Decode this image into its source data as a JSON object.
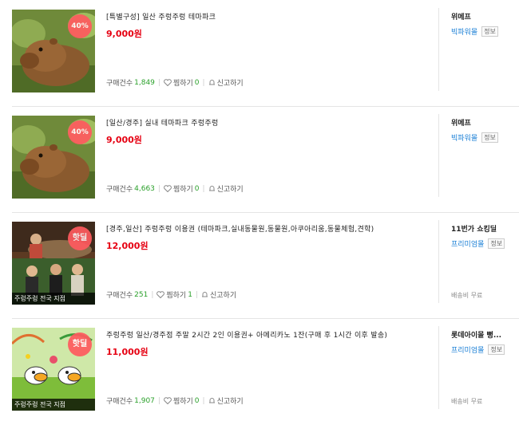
{
  "items": [
    {
      "badge": "40%",
      "caption": "",
      "title": "[특별구성] 일산 주렁주렁 테마파크",
      "price": "9,000원",
      "purchase_label": "구매건수",
      "purchase_count": "1,849",
      "wish_label": "찜하기",
      "wish_count": "0",
      "report_label": "신고하기",
      "seller_name": "위메프",
      "seller_grade": "빅파워몰",
      "info_label": "정보",
      "shipping": ""
    },
    {
      "badge": "40%",
      "caption": "",
      "title": "[일산/경주] 실내 테마파크 주렁주렁",
      "price": "9,000원",
      "purchase_label": "구매건수",
      "purchase_count": "4,663",
      "wish_label": "찜하기",
      "wish_count": "0",
      "report_label": "신고하기",
      "seller_name": "위메프",
      "seller_grade": "빅파워몰",
      "info_label": "정보",
      "shipping": ""
    },
    {
      "badge": "핫딜",
      "caption": "주렁주렁 전국 지점",
      "title": "[경주,일산] 주렁주렁 이용권 (테마파크,실내동물원,동물원,아쿠아리움,동물체험,견학)",
      "price": "12,000원",
      "purchase_label": "구매건수",
      "purchase_count": "251",
      "wish_label": "찜하기",
      "wish_count": "1",
      "report_label": "신고하기",
      "seller_name": "11번가 쇼킹딜",
      "seller_grade": "프리미엄몰",
      "info_label": "정보",
      "shipping": "배송비 무료"
    },
    {
      "badge": "핫딜",
      "caption": "주렁주렁 전국 지점",
      "title": "주렁주렁 일산/경주점 주말 2시간 2인 이용권+ 아메리카노 1잔(구매 후 1시간 이후 발송)",
      "price": "11,000원",
      "purchase_label": "구매건수",
      "purchase_count": "1,907",
      "wish_label": "찜하기",
      "wish_count": "0",
      "report_label": "신고하기",
      "seller_name": "롯데아이몰 뻥...",
      "seller_grade": "프리미엄몰",
      "info_label": "정보",
      "shipping": "배송비 무료"
    }
  ],
  "colors": {
    "price": "#e60012",
    "badge": "#ff5a5f",
    "count": "#2aa02a",
    "grade": "#1a7fd6"
  },
  "icons": {
    "wish": "heart-icon",
    "report": "bell-icon"
  }
}
